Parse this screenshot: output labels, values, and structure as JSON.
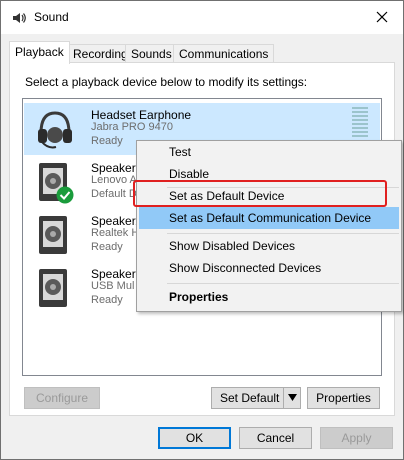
{
  "window": {
    "title": "Sound",
    "title_icon": "speaker-icon"
  },
  "tabs": [
    {
      "label": "Playback",
      "active": true
    },
    {
      "label": "Recording",
      "active": false
    },
    {
      "label": "Sounds",
      "active": false
    },
    {
      "label": "Communications",
      "active": false
    }
  ],
  "playback": {
    "instructions": "Select a playback device below to modify its settings:",
    "devices": [
      {
        "name": "Headset Earphone",
        "sub": "Jabra PRO 9470",
        "status": "Ready",
        "icon": "headset-icon",
        "selected": true
      },
      {
        "name": "Speakers",
        "sub": "Lenovo A",
        "status": "Default D",
        "icon": "speaker-device-icon",
        "badge": "default-check-icon"
      },
      {
        "name": "Speaker/",
        "sub": "Realtek H",
        "status": "Ready",
        "icon": "speaker-device-icon"
      },
      {
        "name": "Speakers",
        "sub": "USB Mul",
        "status": "Ready",
        "icon": "speaker-device-icon"
      }
    ],
    "configure_label": "Configure",
    "set_default_label": "Set Default",
    "properties_label": "Properties"
  },
  "context_menu": {
    "items": [
      {
        "label": "Test"
      },
      {
        "label": "Disable"
      },
      {
        "label": "Set as Default Device",
        "highlighted": true
      },
      {
        "label": "Set as Default Communication Device",
        "hover": true
      },
      {
        "label": "Show Disabled Devices"
      },
      {
        "label": "Show Disconnected Devices"
      },
      {
        "label": "Properties",
        "bold": true
      }
    ]
  },
  "footer": {
    "ok_label": "OK",
    "cancel_label": "Cancel",
    "apply_label": "Apply"
  },
  "colors": {
    "selection": "#cce8ff",
    "menu_hover": "#91c9f7",
    "annotation": "#e02020",
    "accent": "#0078d7"
  }
}
